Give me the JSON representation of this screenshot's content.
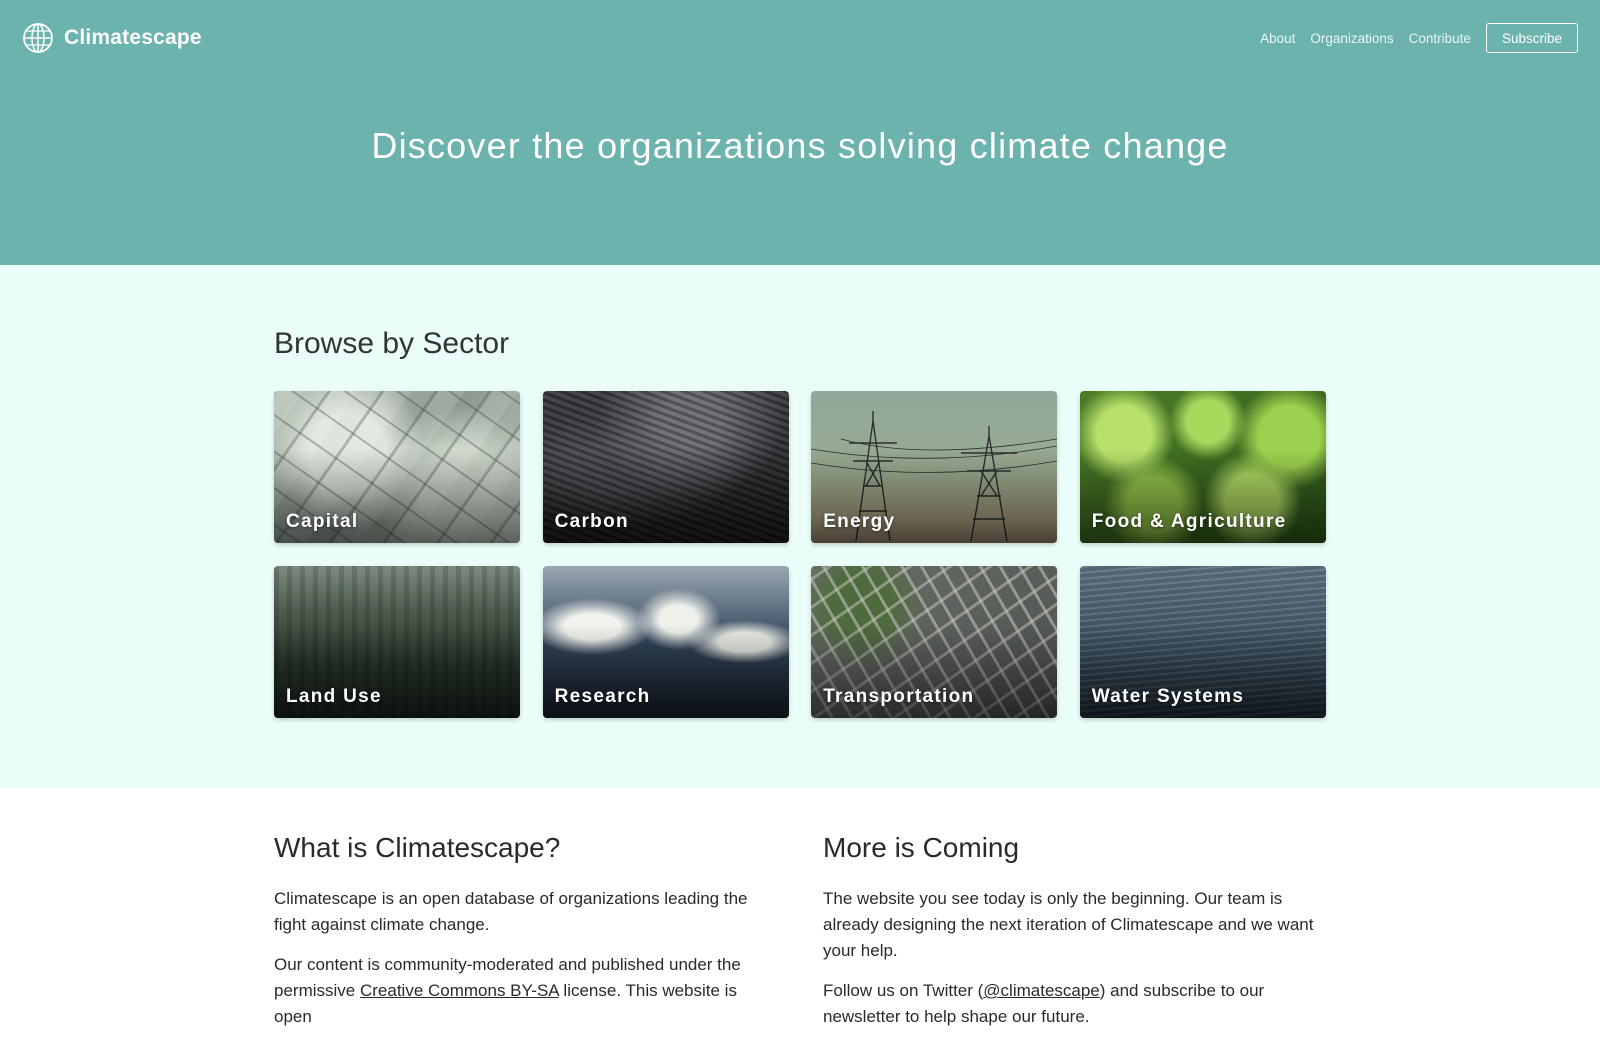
{
  "header": {
    "brand_name": "Climatescape",
    "logo_icon": "globe-icon",
    "nav": {
      "about": "About",
      "organizations": "Organizations",
      "contribute": "Contribute",
      "subscribe": "Subscribe"
    },
    "title": "Discover the organizations solving climate change"
  },
  "sectors": {
    "title": "Browse by Sector",
    "items": [
      {
        "label": "Capital"
      },
      {
        "label": "Carbon"
      },
      {
        "label": "Energy"
      },
      {
        "label": "Food & Agriculture"
      },
      {
        "label": "Land Use"
      },
      {
        "label": "Research"
      },
      {
        "label": "Transportation"
      },
      {
        "label": "Water Systems"
      }
    ]
  },
  "about": {
    "left": {
      "title": "What is Climatescape?",
      "p1": "Climatescape is an open database of organizations leading the fight against climate change.",
      "p2_before": "Our content is community-moderated and published under the permissive ",
      "p2_link": "Creative Commons BY-SA",
      "p2_after": " license. This website is open"
    },
    "right": {
      "title": "More is Coming",
      "p1": "The website you see today is only the beginning. Our team is already designing the next iteration of Climatescape and we want your help.",
      "p2_before": "Follow us on Twitter (",
      "p2_link": "@climatescape",
      "p2_after": ") and subscribe to our newsletter to help shape our future."
    }
  },
  "colors": {
    "hero": "#6bb3ac",
    "sectors_bg": "#eafdf8",
    "text": "#2a2a2a"
  }
}
